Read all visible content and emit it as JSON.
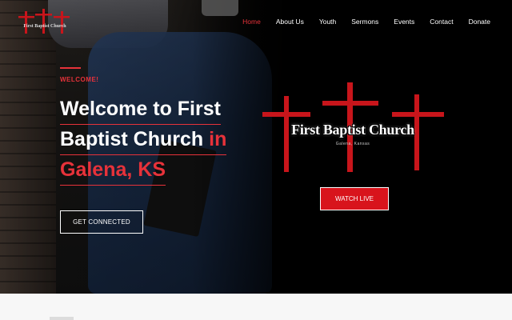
{
  "nav": {
    "items": [
      {
        "label": "Home",
        "active": true
      },
      {
        "label": "About Us",
        "active": false
      },
      {
        "label": "Youth",
        "active": false
      },
      {
        "label": "Sermons",
        "active": false
      },
      {
        "label": "Events",
        "active": false
      },
      {
        "label": "Contact",
        "active": false
      },
      {
        "label": "Donate",
        "active": false
      }
    ]
  },
  "logo": {
    "icon": "three-crosses-logo",
    "text": "First Baptist Church"
  },
  "hero": {
    "eyebrow": "WELCOME!",
    "headline_line1": "Welcome to First",
    "headline_line2_white": "Baptist Church ",
    "headline_line2_red": "in",
    "headline_line3": "Galena, KS",
    "cta_connect": "GET CONNECTED",
    "cta_watch": "WATCH LIVE"
  },
  "church_logo": {
    "name": "First Baptist Church",
    "subtitle": "Galena, Kansas",
    "icon": "three-red-crosses"
  },
  "colors": {
    "accent": "#e7323a",
    "button_red": "#d8141c",
    "background": "#000000",
    "text": "#ffffff"
  }
}
